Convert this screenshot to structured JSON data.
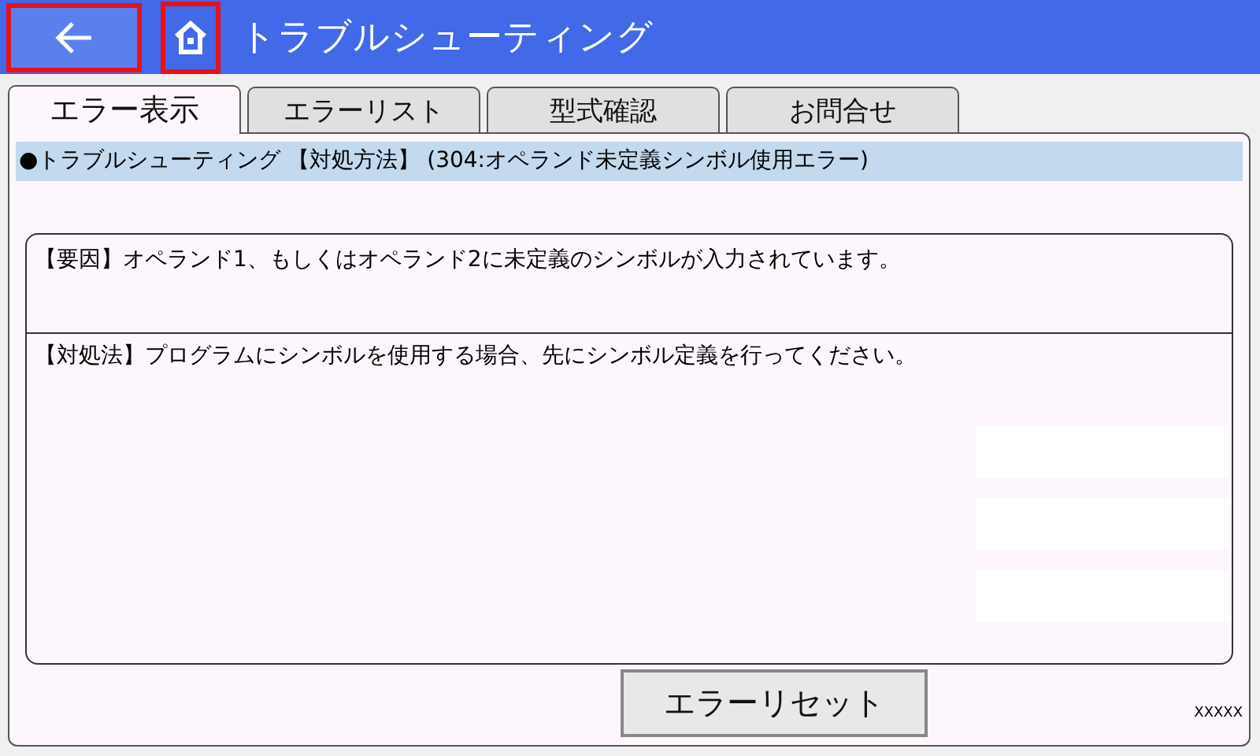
{
  "header": {
    "back_button": {
      "highlighted": true
    },
    "home_button": {
      "highlighted": true
    },
    "title": "トラブルシューティング"
  },
  "tabs": [
    {
      "label": "エラー表示",
      "selected": true
    },
    {
      "label": "エラーリスト",
      "selected": false
    },
    {
      "label": "型式確認",
      "selected": false
    },
    {
      "label": "お問合せ",
      "selected": false
    }
  ],
  "heading": "●トラブルシューティング 【対処方法】 (304:オペランド未定義シンボル使用エラー)",
  "cause": "【要因】オペランド1、もしくはオペランド2に未定義のシンボルが入力されています。",
  "remedy": "【対処法】プログラムにシンボルを使用する場合、先にシンボル定義を行ってください。",
  "reset_button": "エラーリセット",
  "code": "XXXXX"
}
